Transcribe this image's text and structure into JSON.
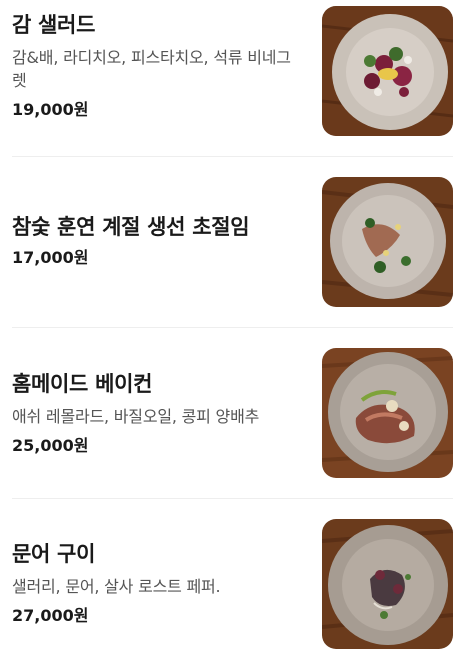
{
  "menu": {
    "items": [
      {
        "name": "감 샐러드",
        "description": "감&배, 라디치오, 피스타치오, 석류 비네그렛",
        "price": "19,000원",
        "photo_icon": "salad-dish-photo"
      },
      {
        "name": "참숯 훈연 계절 생선 초절임",
        "description": "",
        "price": "17,000원",
        "photo_icon": "fish-dish-photo"
      },
      {
        "name": "홈메이드 베이컨",
        "description": "애쉬 레몰라드, 바질오일, 콩피 양배추",
        "price": "25,000원",
        "photo_icon": "bacon-dish-photo"
      },
      {
        "name": "문어 구이",
        "description": "샐러리, 문어, 살사 로스트 페퍼.",
        "price": "27,000원",
        "photo_icon": "octopus-dish-photo"
      }
    ]
  },
  "colors": {
    "title": "#1a1a1a",
    "description": "#555555",
    "divider": "#eeeeee",
    "wood": "#6b3b1c",
    "plate": "#b8aea4"
  }
}
